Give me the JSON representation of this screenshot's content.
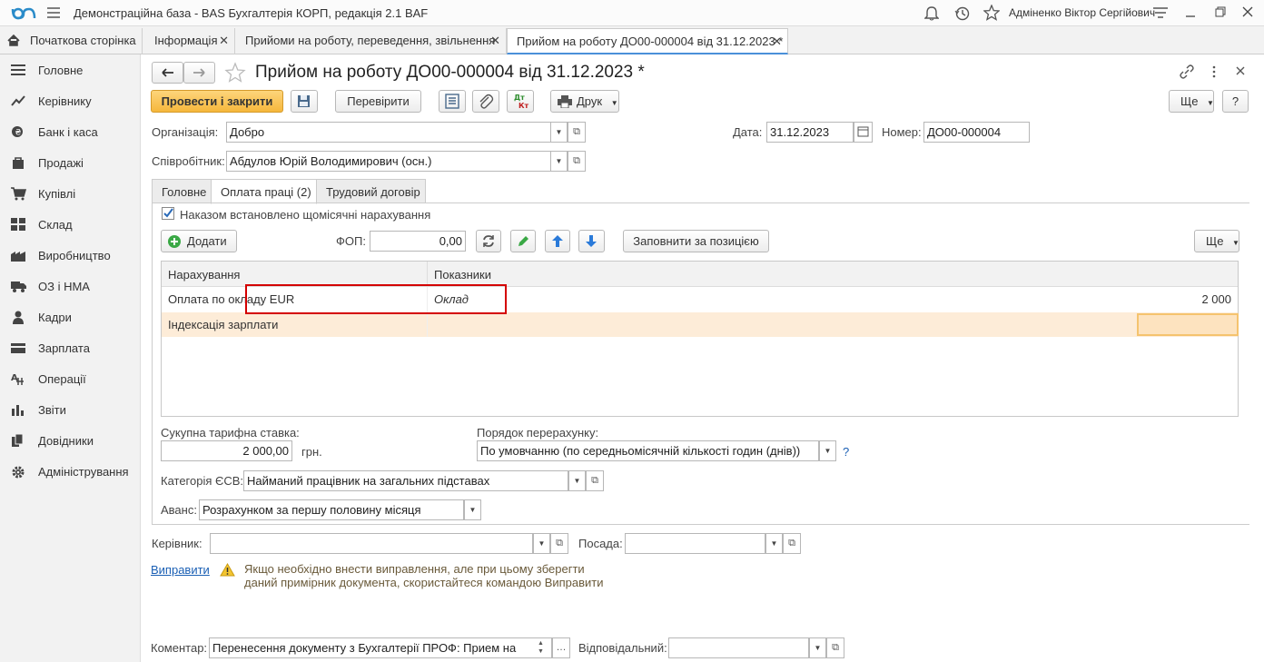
{
  "app": {
    "title": "Демонстраційна база - BAS Бухгалтерія КОРП, редакція 2.1 BAF",
    "user": "Адміненко Віктор Сергійович"
  },
  "tabs": [
    {
      "label": "Початкова сторінка"
    },
    {
      "label": "Інформація"
    },
    {
      "label": "Прийоми на роботу, переведення, звільнення"
    },
    {
      "label": "Прийом на роботу ДО00-000004 від 31.12.2023 *"
    }
  ],
  "sidebar": {
    "items": [
      {
        "label": "Головне",
        "icon": "menu-icon"
      },
      {
        "label": "Керівнику",
        "icon": "chart-line-icon"
      },
      {
        "label": "Банк і каса",
        "icon": "coins-icon"
      },
      {
        "label": "Продажі",
        "icon": "bag-icon"
      },
      {
        "label": "Купівлі",
        "icon": "cart-icon"
      },
      {
        "label": "Склад",
        "icon": "grid-icon"
      },
      {
        "label": "Виробництво",
        "icon": "factory-icon"
      },
      {
        "label": "ОЗ і НМА",
        "icon": "truck-icon"
      },
      {
        "label": "Кадри",
        "icon": "person-icon"
      },
      {
        "label": "Зарплата",
        "icon": "card-icon"
      },
      {
        "label": "Операції",
        "icon": "operations-icon"
      },
      {
        "label": "Звіти",
        "icon": "bar-chart-icon"
      },
      {
        "label": "Довідники",
        "icon": "books-icon"
      },
      {
        "label": "Адміністрування",
        "icon": "gear-icon"
      }
    ]
  },
  "doc": {
    "title": "Прийом на роботу ДО00-000004 від 31.12.2023 *",
    "toolbar": {
      "post_close": "Провести і закрити",
      "check": "Перевірити",
      "print": "Друк",
      "more": "Ще",
      "help": "?"
    },
    "org_label": "Організація:",
    "org_value": "Добро",
    "date_label": "Дата:",
    "date_value": "31.12.2023",
    "number_label": "Номер:",
    "number_value": "ДО00-000004",
    "employee_label": "Співробітник:",
    "employee_value": "Абдулов Юрій Володимирович (осн.)",
    "inner_tabs": [
      "Головне",
      "Оплата праці (2)",
      "Трудовий договір"
    ],
    "checkbox_label": "Наказом встановлено щомісячні нарахування",
    "add_label": "Додати",
    "fop_label": "ФОП:",
    "fop_value": "0,00",
    "fill_by_position": "Заповнити за позицією",
    "more2": "Ще",
    "table": {
      "headers": [
        "Нарахування",
        "Показники"
      ],
      "rows": [
        {
          "accrual": "Оплата по окладу EUR",
          "indicator": "Оклад",
          "value": "2 000"
        },
        {
          "accrual": "Індексація зарплати",
          "indicator": "",
          "value": ""
        }
      ]
    },
    "total_rate_label": "Сукупна тарифна ставка:",
    "total_rate_value": "2 000,00",
    "currency": "грн.",
    "recalc_label": "Порядок перерахунку:",
    "recalc_value": "По умовчанню (по середньомісячній кількості годин (днів))",
    "recalc_help": "?",
    "esv_label": "Категорія ЄСВ:",
    "esv_value": "Найманий працівник на загальних підставах",
    "advance_label": "Аванс:",
    "advance_value": "Розрахунком за першу половину місяця",
    "manager_label": "Керівник:",
    "manager_value": "",
    "position_label": "Посада:",
    "position_value": "",
    "fix_link": "Виправити",
    "warning_line1": "Якщо необхідно внести виправлення, але при цьому зберегти",
    "warning_line2": "даний примірник документа, скористайтеся командою Виправити",
    "comment_label": "Коментар:",
    "comment_value": "Перенесення документу з Бухгалтерії ПРОФ: Прием на",
    "responsible_label": "Відповідальний:",
    "responsible_value": ""
  },
  "colors": {
    "primary": "#f6b73c",
    "highlight_row": "#fdecd8",
    "red_box": "#d40000",
    "link": "#1a5fb4"
  }
}
